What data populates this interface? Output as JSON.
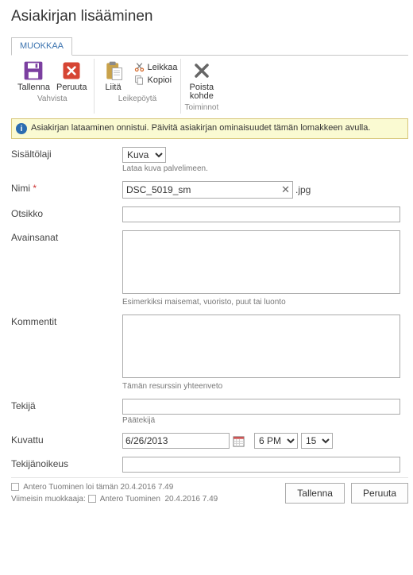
{
  "page_title": "Asiakirjan lisääminen",
  "tab_label": "MUOKKAA",
  "ribbon": {
    "groups": {
      "vahvista": {
        "title": "Vahvista",
        "save": "Tallenna",
        "cancel": "Peruuta"
      },
      "leikepoyta": {
        "title": "Leikepöytä",
        "paste": "Liitä",
        "cut": "Leikkaa",
        "copy": "Kopioi"
      },
      "toiminnot": {
        "title": "Toiminnot",
        "delete_line1": "Poista",
        "delete_line2": "kohde"
      }
    }
  },
  "notice_text": "Asiakirjan lataaminen onnistui. Päivitä asiakirjan ominaisuudet tämän lomakkeen avulla.",
  "form": {
    "content_type": {
      "label": "Sisältölaji",
      "value": "Kuva",
      "help": "Lataa kuva palvelimeen."
    },
    "name": {
      "label": "Nimi",
      "value": "DSC_5019_sm",
      "ext": ".jpg"
    },
    "title": {
      "label": "Otsikko",
      "value": ""
    },
    "keywords": {
      "label": "Avainsanat",
      "value": "",
      "help": "Esimerkiksi maisemat, vuoristo, puut tai luonto"
    },
    "comments": {
      "label": "Kommentit",
      "value": "",
      "help": "Tämän resurssin yhteenveto"
    },
    "author": {
      "label": "Tekijä",
      "value": "",
      "help": "Päätekijä"
    },
    "captured": {
      "label": "Kuvattu",
      "date": "6/26/2013",
      "hour": "6 PM",
      "minute": "15"
    },
    "copyright": {
      "label": "Tekijänoikeus",
      "value": ""
    }
  },
  "footer": {
    "created_user": "Antero Tuominen",
    "created_mid": " loi tämän ",
    "created_ts": "20.4.2016 7.49",
    "modified_label": "Viimeisin muokkaaja: ",
    "modified_user": "Antero Tuominen",
    "modified_ts": "20.4.2016 7.49",
    "save": "Tallenna",
    "cancel": "Peruuta"
  }
}
